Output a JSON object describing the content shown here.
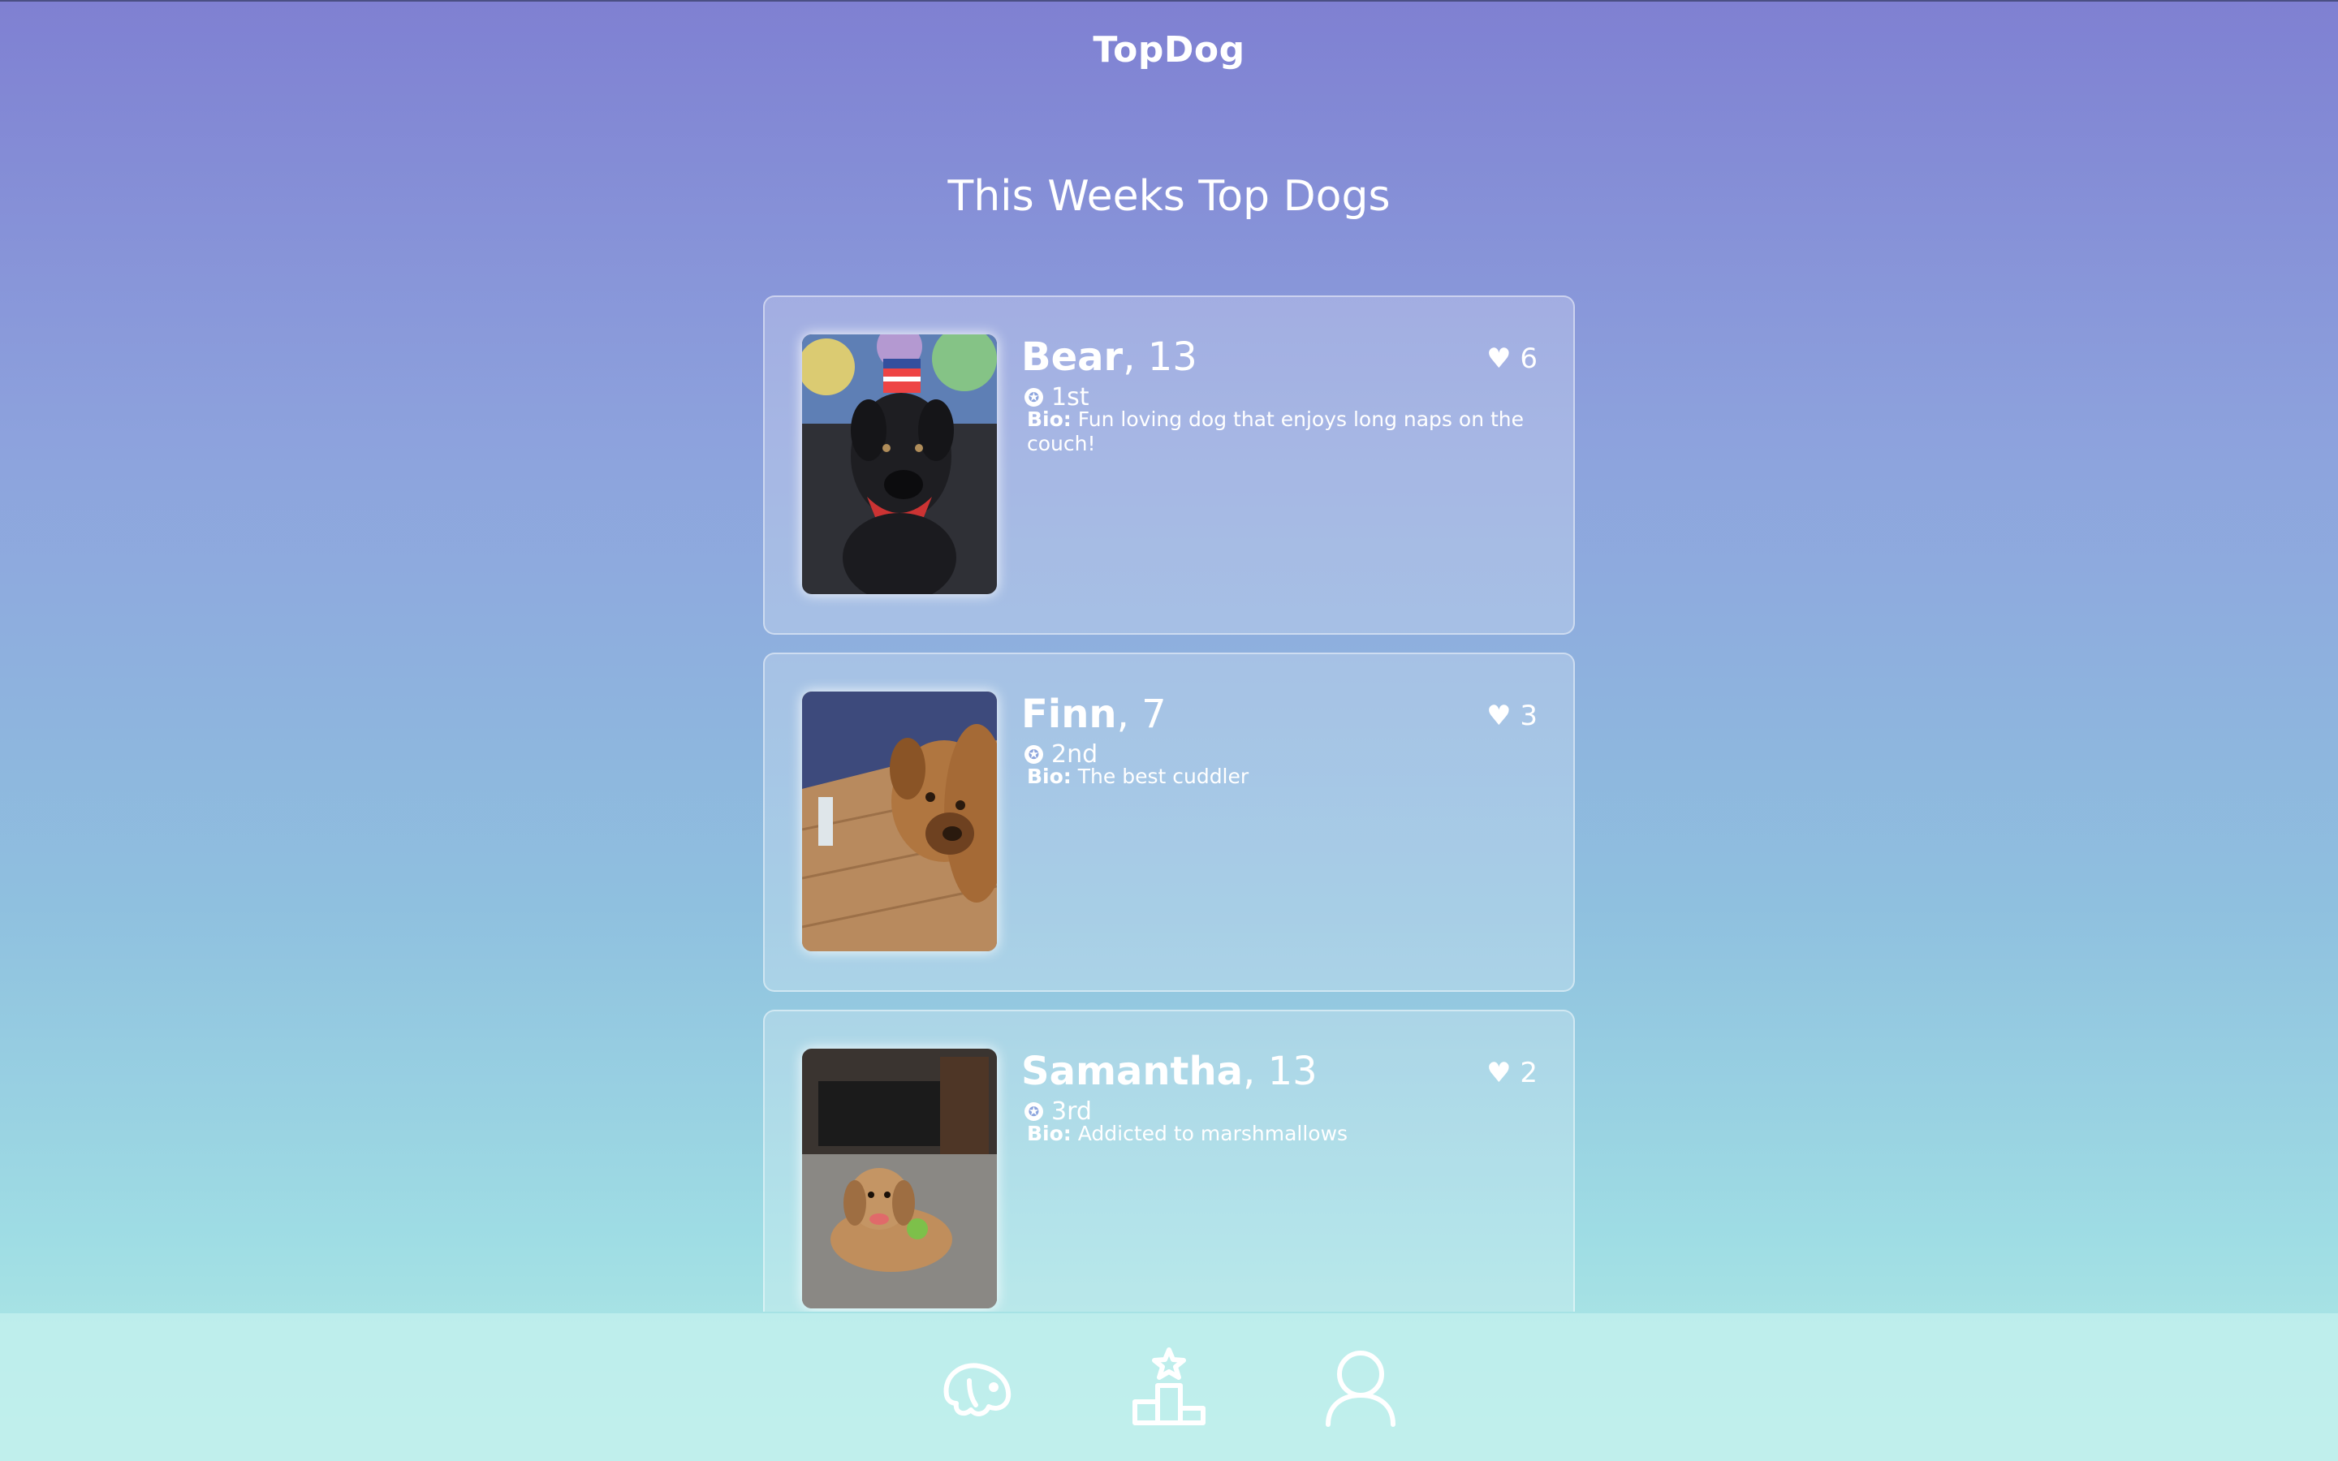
{
  "header": {
    "title": "TopDog"
  },
  "main": {
    "title": "This Weeks Top Dogs"
  },
  "dogs": [
    {
      "name": "Bear",
      "age": "13",
      "likes": "6",
      "rank": "1st",
      "bio_label": "Bio:",
      "bio": "Fun loving dog that enjoys long naps on the couch!",
      "photo": "black dog wearing a stars and stripes hat"
    },
    {
      "name": "Finn",
      "age": "7",
      "likes": "3",
      "rank": "2nd",
      "bio_label": "Bio:",
      "bio": "The best cuddler",
      "photo": "tan dog looking up from a wooden floor"
    },
    {
      "name": "Samantha",
      "age": "13",
      "likes": "2",
      "rank": "3rd",
      "bio_label": "Bio:",
      "bio": "Addicted to marshmallows",
      "photo": "small fluffy dog lying on a gray rug"
    }
  ],
  "icons": {
    "like": "heart-icon",
    "rank": "award-icon"
  },
  "nav": [
    {
      "name": "dog-icon"
    },
    {
      "name": "podium-icon"
    },
    {
      "name": "profile-icon"
    }
  ],
  "colors": {
    "gradient_top": "#7f80d2",
    "gradient_bottom": "#b6ece6",
    "text": "#ffffff"
  }
}
